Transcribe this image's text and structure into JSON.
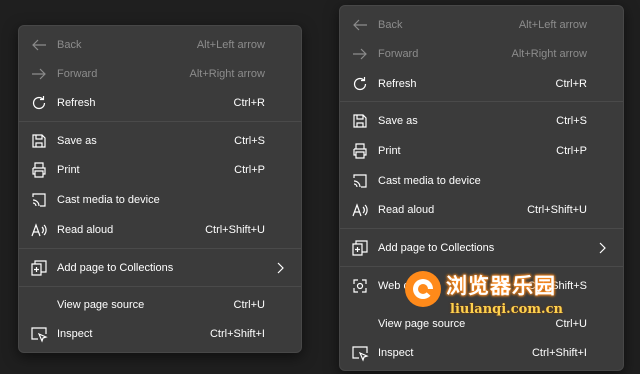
{
  "colors": {
    "menu_bg": "#3b3b3b",
    "page_bg": "#1f1f1f",
    "text": "#ffffff",
    "disabled_text": "#8c8c8c",
    "separator": "#4a4a4a",
    "watermark_orange": "#ff8a1a"
  },
  "left_menu": {
    "back": {
      "label": "Back",
      "shortcut": "Alt+Left arrow",
      "icon": "arrow-left-icon"
    },
    "forward": {
      "label": "Forward",
      "shortcut": "Alt+Right arrow",
      "icon": "arrow-right-icon"
    },
    "refresh": {
      "label": "Refresh",
      "shortcut": "Ctrl+R",
      "icon": "refresh-icon"
    },
    "save_as": {
      "label": "Save as",
      "shortcut": "Ctrl+S",
      "icon": "save-icon"
    },
    "print": {
      "label": "Print",
      "shortcut": "Ctrl+P",
      "icon": "printer-icon"
    },
    "cast": {
      "label": "Cast media to device",
      "icon": "cast-icon"
    },
    "read_aloud": {
      "label": "Read aloud",
      "shortcut": "Ctrl+Shift+U",
      "icon": "read-aloud-icon"
    },
    "collections": {
      "label": "Add page to Collections",
      "icon": "collections-icon"
    },
    "view_source": {
      "label": "View page source",
      "shortcut": "Ctrl+U"
    },
    "inspect": {
      "label": "Inspect",
      "shortcut": "Ctrl+Shift+I",
      "icon": "inspect-icon"
    }
  },
  "right_menu": {
    "back": {
      "label": "Back",
      "shortcut": "Alt+Left arrow",
      "icon": "arrow-left-icon"
    },
    "forward": {
      "label": "Forward",
      "shortcut": "Alt+Right arrow",
      "icon": "arrow-right-icon"
    },
    "refresh": {
      "label": "Refresh",
      "shortcut": "Ctrl+R",
      "icon": "refresh-icon"
    },
    "save_as": {
      "label": "Save as",
      "shortcut": "Ctrl+S",
      "icon": "save-icon"
    },
    "print": {
      "label": "Print",
      "shortcut": "Ctrl+P",
      "icon": "printer-icon"
    },
    "cast": {
      "label": "Cast media to device",
      "icon": "cast-icon"
    },
    "read_aloud": {
      "label": "Read aloud",
      "shortcut": "Ctrl+Shift+U",
      "icon": "read-aloud-icon"
    },
    "collections": {
      "label": "Add page to Collections",
      "icon": "collections-icon"
    },
    "web_capture": {
      "label": "Web capture",
      "shortcut": "Ctrl+Shift+S",
      "icon": "web-capture-icon"
    },
    "view_source": {
      "label": "View page source",
      "shortcut": "Ctrl+U"
    },
    "inspect": {
      "label": "Inspect",
      "shortcut": "Ctrl+Shift+I",
      "icon": "inspect-icon"
    }
  },
  "watermark": {
    "title": "浏览器乐园",
    "url": "liulanqi.com.cn",
    "icon": "watermark-logo-icon"
  }
}
